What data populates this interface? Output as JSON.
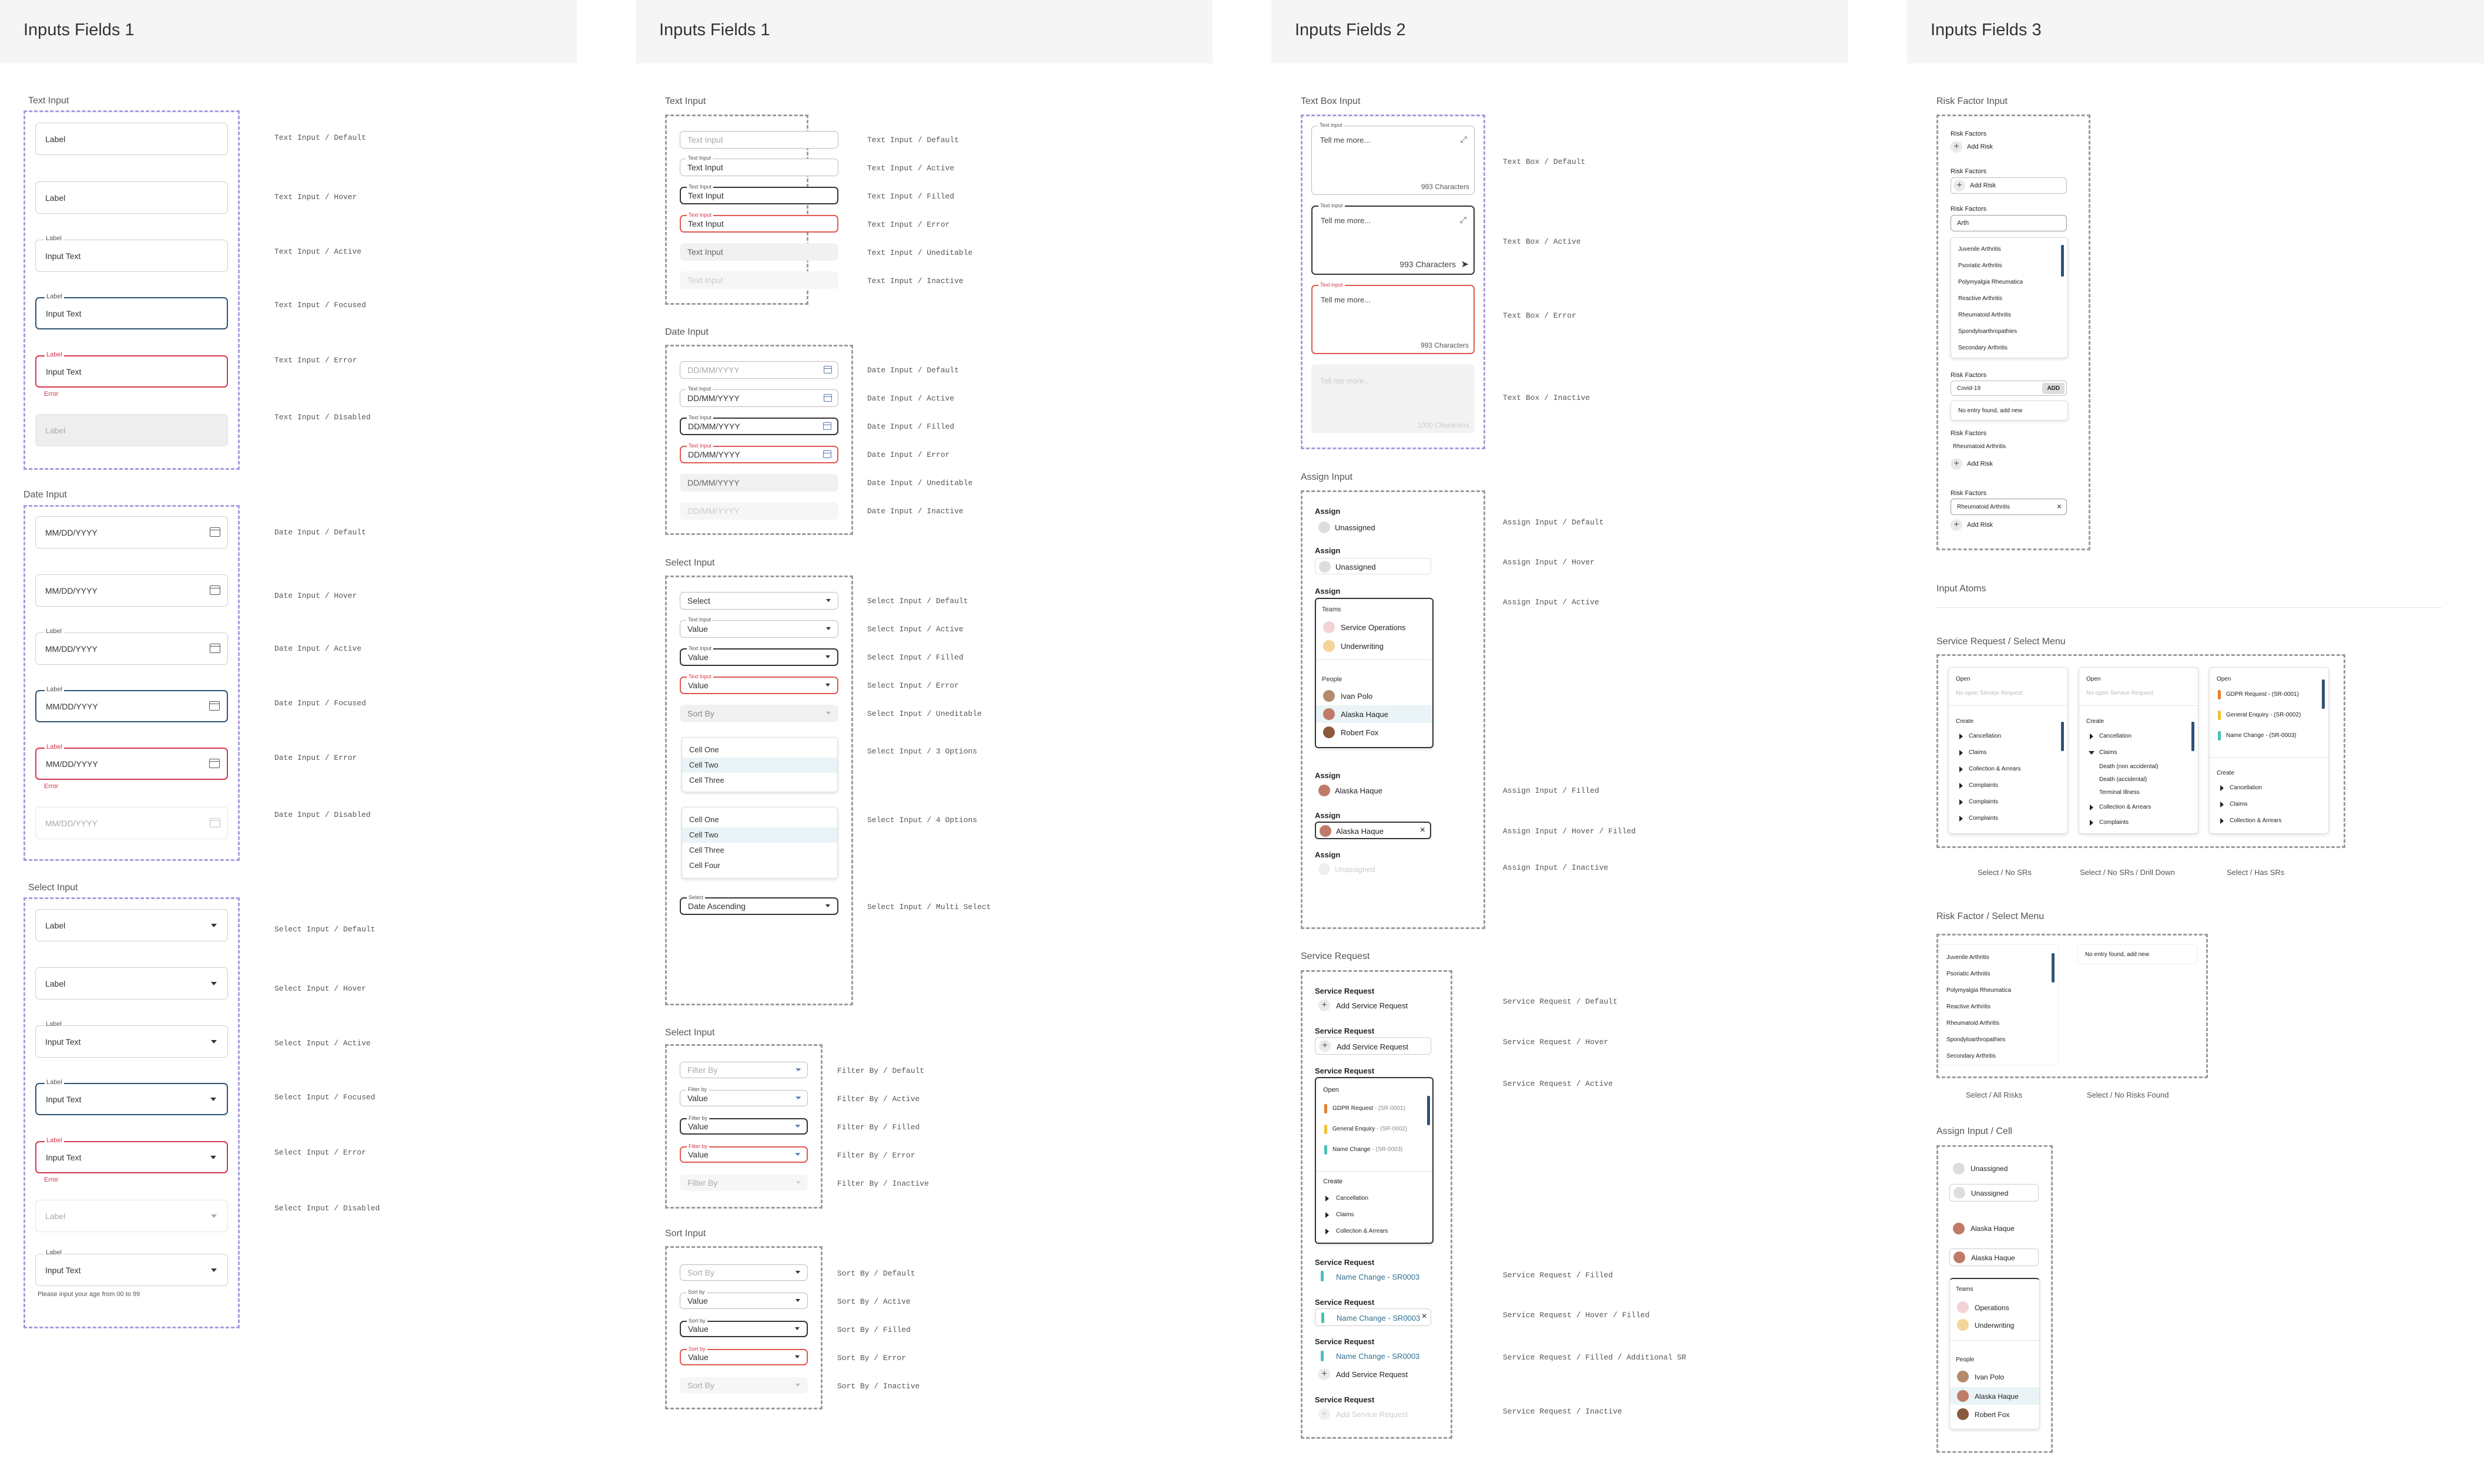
{
  "columns": [
    "Inputs Fields 1",
    "Inputs Fields 1",
    "Inputs Fields 2",
    "Inputs Fields 3"
  ],
  "col1": {
    "sections": [
      "Text Input",
      "Date Input",
      "Select Input"
    ],
    "text": {
      "label": "Label",
      "value": "Input Text",
      "error": "Error",
      "notes": [
        "Text Input / Default",
        "Text Input / Hover",
        "Text Input / Active",
        "Text Input / Focused",
        "Text Input / Error",
        "Text Input / Disabled"
      ]
    },
    "date": {
      "placeholder": "MM/DD/YYYY",
      "label": "Label",
      "error": "Error",
      "notes": [
        "Date Input / Default",
        "Date Input / Hover",
        "Date Input / Active",
        "Date Input / Focused",
        "Date Input / Error",
        "Date Input / Disabled"
      ]
    },
    "select": {
      "label": "Label",
      "value": "Input Text",
      "error": "Error",
      "help": "Please input your age from 00 to 99",
      "notes": [
        "Select Input / Default",
        "Select Input / Hover",
        "Select Input / Active",
        "Select Input / Focused",
        "Select Input / Error",
        "Select Input / Disabled"
      ]
    }
  },
  "col2": {
    "sections": [
      "Text Input",
      "Date Input",
      "Select Input",
      "Select Input",
      "Sort Input"
    ],
    "text": {
      "placeholder": "Text Input",
      "label": "Text Input",
      "value": "Text Input",
      "notes": [
        "Text Input / Default",
        "Text Input / Active",
        "Text Input / Filled",
        "Text Input / Error",
        "Text Input / Uneditable",
        "Text Input / Inactive"
      ]
    },
    "date": {
      "placeholder": "DD/MM/YYYY",
      "label": "Text Input",
      "notes": [
        "Date Input / Default",
        "Date Input / Active",
        "Date Input / Filled",
        "Date Input / Error",
        "Date Input / Uneditable",
        "Date Input / Inactive"
      ]
    },
    "select": {
      "placeholder": "Select",
      "label": "Text Input",
      "value": "Value",
      "sortby": "Sort By",
      "options3": [
        "Cell One",
        "Cell Two",
        "Cell Three"
      ],
      "options4": [
        "Cell One",
        "Cell Two",
        "Cell Three",
        "Cell Four"
      ],
      "multi_label": "Select",
      "multi_value": "Date Ascending",
      "notes": [
        "Select Input / Default",
        "Select Input / Active",
        "Select Input / Filled",
        "Select Input / Error",
        "Select Input / Uneditable",
        "Select Input / 3 Options",
        "Select Input / 4 Options",
        "Select Input / Multi Select"
      ]
    },
    "filter": {
      "placeholder": "Filter By",
      "label": "Filter by",
      "value": "Value",
      "notes": [
        "Filter By / Default",
        "Filter By / Active",
        "Filter By / Filled",
        "Filter By / Error",
        "Filter By / Inactive"
      ]
    },
    "sort": {
      "placeholder": "Sort By",
      "label": "Sort by",
      "value": "Value",
      "notes": [
        "Sort By / Default",
        "Sort By / Active",
        "Sort By / Filled",
        "Sort By / Error",
        "Sort By / Inactive"
      ]
    }
  },
  "col3": {
    "sections": [
      "Text Box Input",
      "Assign Input",
      "Service Request"
    ],
    "textbox": {
      "label": "Text input",
      "placeholder": "Tell me more...",
      "count": "993 Characters",
      "count_inactive": "1000 Characters",
      "notes": [
        "Text Box / Default",
        "Text Box / Active",
        "Text Box / Error",
        "Text Box / Inactive"
      ]
    },
    "assign": {
      "title": "Assign",
      "unassigned": "Unassigned",
      "teams_header": "Teams",
      "teams": [
        "Service Operations",
        "Underwriting"
      ],
      "people_header": "People",
      "people": [
        "Ivan Polo",
        "Alaska Haque",
        "Robert Fox"
      ],
      "filled": "Alaska Haque",
      "notes": [
        "Assign Input / Default",
        "Assign Input / Hover",
        "Assign Input / Active",
        "Assign Input / Filled",
        "Assign Input / Hover / Filled",
        "Assign Input / Inactive"
      ]
    },
    "sr": {
      "title": "Service Request",
      "add": "Add Service Request",
      "open_header": "Open",
      "open_items": [
        {
          "name": "GDPR Request",
          "code": " - (SR-0001)"
        },
        {
          "name": "General Enquiry",
          "code": " - (SR-0002)"
        },
        {
          "name": "Name Change",
          "code": " - (SR-0003)"
        }
      ],
      "create_header": "Create",
      "create_items": [
        "Cancellation",
        "Claims",
        "Collection & Arrears"
      ],
      "filled": "Name Change - SR0003",
      "notes": [
        "Service Request / Default",
        "Service Request / Hover",
        "Service Request / Active",
        "Service Request / Filled",
        "Service Request / Hover / Filled",
        "Service Request / Filled / Additional SR",
        "Service Request / Inactive"
      ]
    }
  },
  "col4": {
    "sections": [
      "Risk Factor Input",
      "Input Atoms",
      "Service Request / Select Menu",
      "Risk Factor / Select Menu",
      "Assign Input  / Cell"
    ],
    "risk": {
      "title": "Risk Factors",
      "add": "Add Risk",
      "search": "Arth",
      "list": [
        "Juvenile Arthritis",
        "Psoriatic Arthritis",
        "Polymyalgia Rheumatica",
        "Reactive Arthritis",
        "Rheumatoid Arthritis",
        "Spondyloarthropathies",
        "Secondary Arthritis"
      ],
      "covid": "Covid-19",
      "add_btn": "ADD",
      "no_entry": "No entry found, add new",
      "selected": "Rheumatoid Arthritis",
      "clear": "×"
    },
    "srmenu": {
      "open": "Open",
      "open_placeholder": "No open Service Request",
      "create": "Create",
      "items_a": [
        "Cancellation",
        "Claims",
        "Collection & Arrears",
        "Complaints",
        "Complaints",
        "Complaints",
        "Complaints"
      ],
      "items_b": [
        "Cancellation",
        "Claims"
      ],
      "claims_sub": [
        "Death (non accidental)",
        "Death (accidental)",
        "Terminal Illness"
      ],
      "items_b2": [
        "Collection & Arrears",
        "Complaints"
      ],
      "open_items": [
        "GDPR Request - (SR-0001)",
        "General Enquiry - (SR-0002)",
        "Name Change - (SR-0003)"
      ],
      "items_c": [
        "Cancellation",
        "Claims",
        "Collection & Arrears"
      ],
      "captions": [
        "Select / No SRs",
        "Select / No SRs / Drill Down",
        "Select / Has SRs"
      ]
    },
    "riskmenu": {
      "captions": [
        "Select / All Risks",
        "Select / No Risks Found"
      ]
    },
    "cell": {
      "unassigned": "Unassigned",
      "filled": "Alaska Haque",
      "teams_header": "Teams",
      "teams": [
        "Operations",
        "Underwriting"
      ],
      "people_header": "People",
      "people": [
        "Ivan Polo",
        "Alaska Haque",
        "Robert Fox"
      ]
    }
  },
  "colors": {
    "accent": "#2f5375",
    "error": "#d4364b",
    "frame_purple": "#a79ce0",
    "bar_orange": "#e97c2b",
    "bar_yellow": "#f1c230",
    "bar_teal": "#49c1b8"
  }
}
